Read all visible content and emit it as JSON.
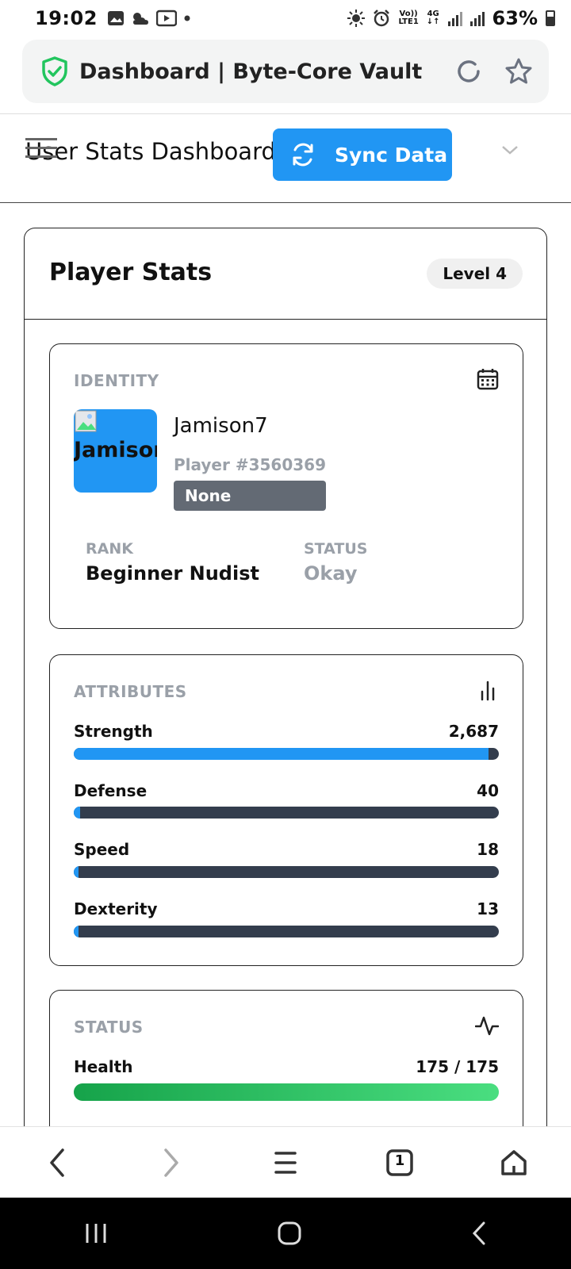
{
  "status_bar": {
    "time": "19:02",
    "network_top": "Vo))",
    "network_bottom": "LTE1",
    "net_gen": "4G",
    "battery": "63%"
  },
  "browser": {
    "title": "Dashboard | Byte-Core Vault",
    "tab_count": "1"
  },
  "header": {
    "title": "User Stats Dashboard",
    "sync_label": "Sync Data"
  },
  "panel": {
    "title": "Player Stats",
    "level": "Level 4"
  },
  "identity": {
    "label": "IDENTITY",
    "avatar_alt": "Jamison7",
    "name": "Jamison7",
    "player_id": "Player #3560369",
    "tag": "None",
    "rank_label": "RANK",
    "rank_value": "Beginner Nudist",
    "status_label": "STATUS",
    "status_value": "Okay"
  },
  "attributes": {
    "label": "ATTRIBUTES",
    "items": [
      {
        "name": "Strength",
        "value": "2,687",
        "fill": 0.975
      },
      {
        "name": "Defense",
        "value": "40",
        "fill": 0.015
      },
      {
        "name": "Speed",
        "value": "18",
        "fill": 0.007
      },
      {
        "name": "Dexterity",
        "value": "13",
        "fill": 0.005
      }
    ]
  },
  "status": {
    "label": "STATUS",
    "health_label": "Health",
    "health_value": "175 / 175",
    "health_fill": 1.0
  },
  "colors": {
    "accent": "#2196f3",
    "bar_track": "#333d4d",
    "health": "#22c55e",
    "shield": "#22c55e",
    "muted": "#9aa0a8"
  },
  "icons": [
    "shield-check-icon",
    "reload-icon",
    "star-icon",
    "hamburger-icon",
    "sync-icon",
    "chevron-down-icon",
    "calendar-icon",
    "bar-chart-icon",
    "activity-icon",
    "back-icon",
    "forward-icon",
    "menu-icon",
    "tabs-icon",
    "home-icon"
  ]
}
